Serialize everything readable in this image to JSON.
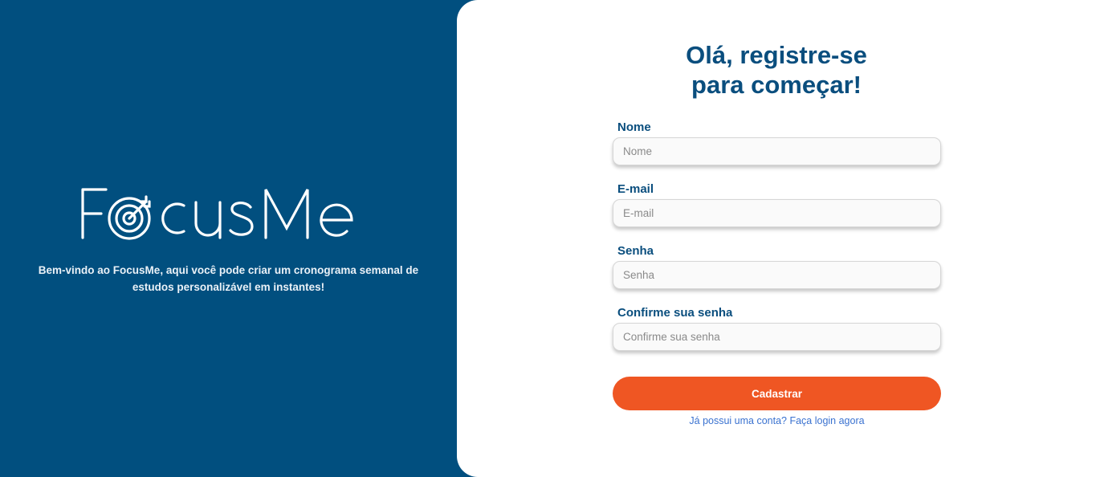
{
  "brand": {
    "logo_text": "FocusMe",
    "tagline": "Bem-vindo ao FocusMe, aqui você pode criar um cronograma semanal de estudos personalizável em instantes!",
    "panel_color": "#014f7f"
  },
  "form": {
    "title_line1": "Olá, registre-se",
    "title_line2": "para começar!",
    "fields": [
      {
        "label": "Nome",
        "placeholder": "Nome",
        "value": ""
      },
      {
        "label": "E-mail",
        "placeholder": "E-mail",
        "value": ""
      },
      {
        "label": "Senha",
        "placeholder": "Senha",
        "value": ""
      },
      {
        "label": "Confirme sua senha",
        "placeholder": "Confirme sua senha",
        "value": ""
      }
    ],
    "submit_label": "Cadastrar",
    "login_link": "Já possui uma conta? Faça login agora"
  },
  "colors": {
    "title": "#0a4e7e",
    "button": "#ef5623",
    "link": "#3a72d0"
  }
}
